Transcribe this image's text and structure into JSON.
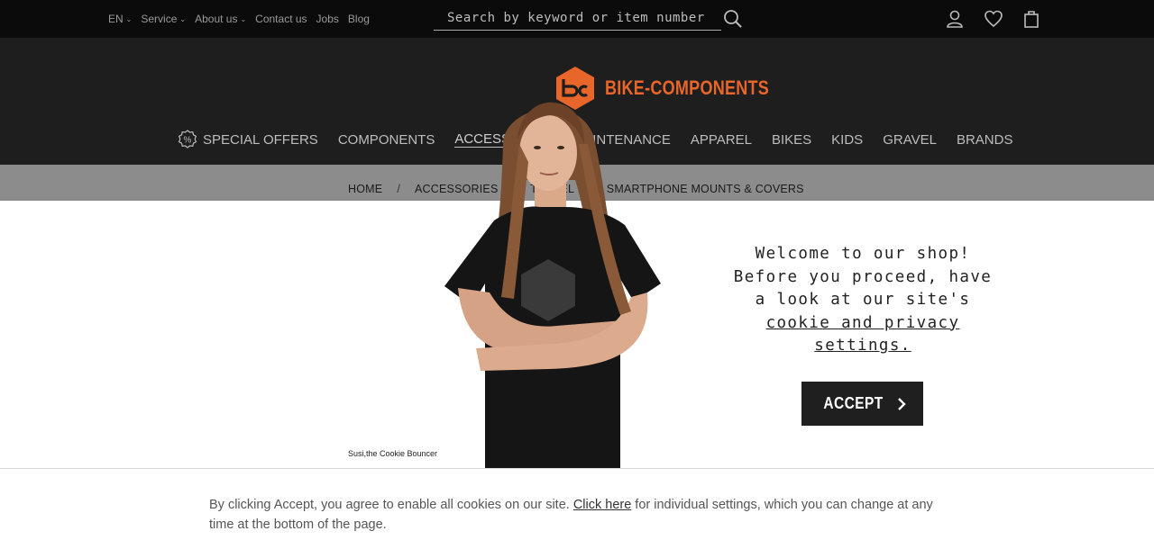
{
  "topbar": {
    "links": [
      {
        "label": "EN",
        "dropdown": true
      },
      {
        "label": "Service",
        "dropdown": true
      },
      {
        "label": "About us",
        "dropdown": true
      },
      {
        "label": "Contact us",
        "dropdown": false
      },
      {
        "label": "Jobs",
        "dropdown": false
      },
      {
        "label": "Blog",
        "dropdown": false
      }
    ],
    "search_placeholder": "Search by keyword or item number",
    "icons": [
      "search-icon",
      "user-icon",
      "heart-icon",
      "cart-icon"
    ]
  },
  "header": {
    "brand": "BIKE-COMPONENTS",
    "brand_color": "#e8662a",
    "nav": [
      {
        "label": "SPECIAL OFFERS"
      },
      {
        "label": "COMPONENTS"
      },
      {
        "label": "ACCESSORIES"
      },
      {
        "label": "MAINTENANCE"
      },
      {
        "label": "APPAREL"
      },
      {
        "label": "BIKES"
      },
      {
        "label": "KIDS"
      },
      {
        "label": "GRAVEL"
      },
      {
        "label": "BRANDS"
      }
    ]
  },
  "breadcrumb": [
    "HOME",
    "ACCESSORIES",
    "TRAVEL",
    "SMARTPHONE MOUNTS & COVERS"
  ],
  "cookie": {
    "caption": "Susi,the Cookie Bouncer",
    "welcome_line1": "Welcome to our shop!",
    "welcome_line2": "Before you proceed, have",
    "welcome_line3": "a look at our site's",
    "welcome_link": "cookie and privacy settings.",
    "accept_label": "ACCEPT",
    "consent_before": "By clicking Accept, you agree to enable all cookies on our site. ",
    "consent_link": "Click here",
    "consent_after": " for individual settings, which you can change at any time at the bottom of the page."
  }
}
